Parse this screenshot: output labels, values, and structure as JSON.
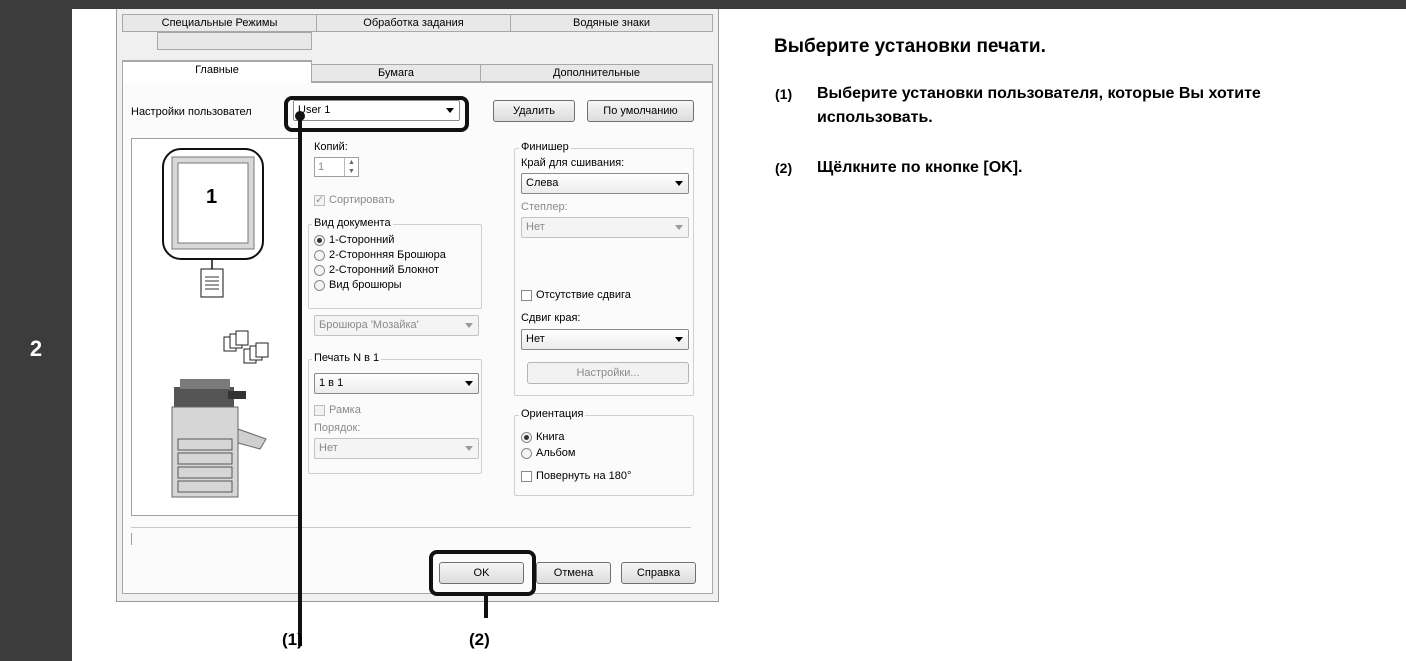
{
  "step": {
    "number": "2"
  },
  "dialog": {
    "tabs_back": [
      "Специальные Режимы",
      "Обработка задания",
      "Водяные знаки"
    ],
    "tabs_front": [
      "Главные",
      "Бумага",
      "Дополнительные"
    ],
    "active_tab": "Главные",
    "user_settings": {
      "label": "Настройки пользовател",
      "value": "User 1",
      "delete_label": "Удалить",
      "default_label": "По умолчанию"
    },
    "preview": {
      "page_number": "1"
    },
    "copies": {
      "label": "Копий:",
      "value": "1"
    },
    "collate_label": "Сортировать",
    "document_style": {
      "title": "Вид документа",
      "options": [
        "1-Сторонний",
        "2-Сторонняя Брошюра",
        "2-Сторонний Блокнот",
        "Вид брошюры"
      ],
      "selected": "1-Сторонний"
    },
    "booklet_select": "Брошюра 'Мозайка'",
    "nup": {
      "title": "Печать N в 1",
      "value": "1 в 1",
      "border_label": "Рамка",
      "order_label": "Порядок:",
      "order_value": "Нет"
    },
    "finisher": {
      "title": "Финишер",
      "binding_label": "Край для сшивания:",
      "binding_value": "Слева",
      "staple_label": "Степлер:",
      "staple_value": "Нет",
      "no_offset_label": "Отсутствие сдвига",
      "margin_shift_label": "Сдвиг края:",
      "margin_shift_value": "Нет",
      "settings_button": "Настройки..."
    },
    "orientation": {
      "title": "Ориентация",
      "options": [
        "Книга",
        "Альбом"
      ],
      "selected": "Книга",
      "rotate_label": "Повернуть на 180°"
    },
    "buttons": {
      "ok": "OK",
      "cancel": "Отмена",
      "help": "Справка"
    }
  },
  "callouts": {
    "one": "(1)",
    "two": "(2)"
  },
  "instructions": {
    "heading": "Выберите установки печати.",
    "steps": [
      {
        "num": "(1)",
        "text": "Выберите установки пользователя, которые Вы хотите использовать."
      },
      {
        "num": "(2)",
        "text": "Щёлкните по кнопке [OK]."
      }
    ]
  }
}
